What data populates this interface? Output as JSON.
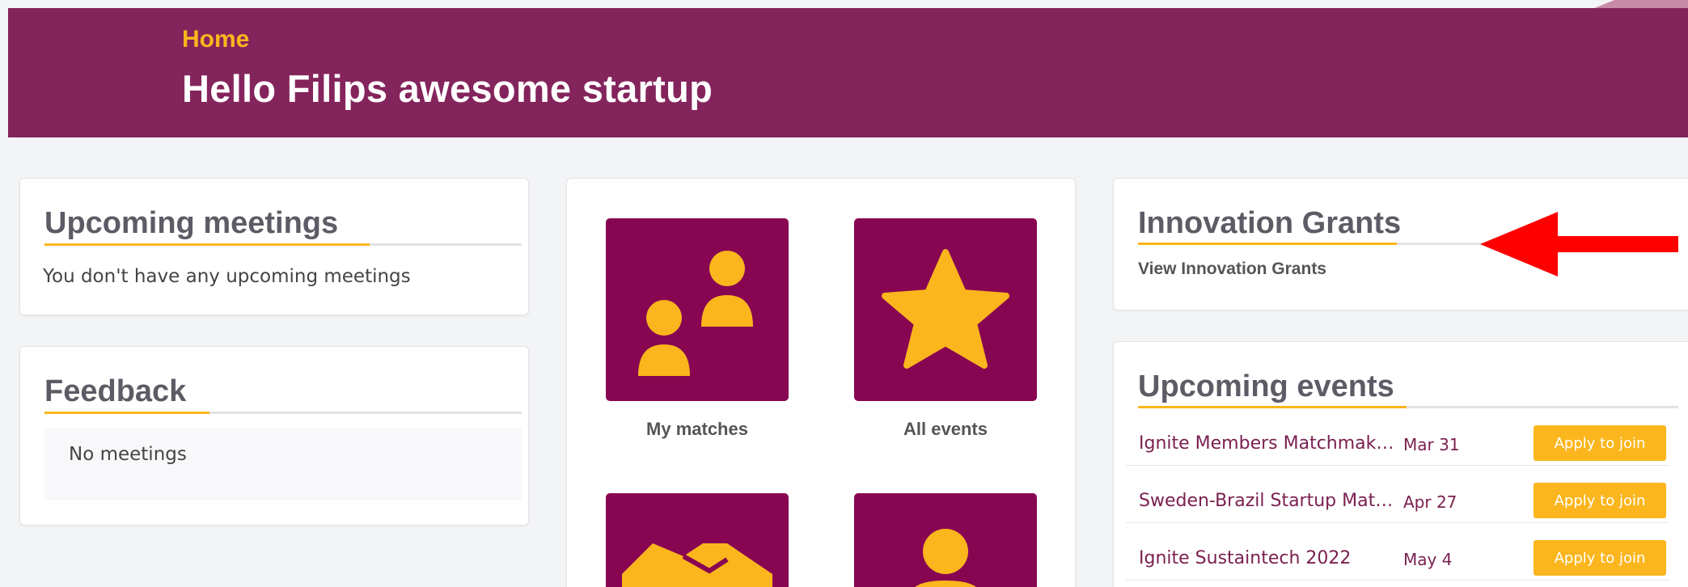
{
  "header": {
    "breadcrumb": "Home",
    "title": "Hello Filips awesome startup"
  },
  "meetings": {
    "title": "Upcoming meetings",
    "empty_text": "You don't have any upcoming meetings"
  },
  "feedback": {
    "title": "Feedback",
    "empty_text": "No meetings"
  },
  "tiles": [
    {
      "label": "My matches",
      "icon": "people-icon"
    },
    {
      "label": "All events",
      "icon": "star-icon"
    },
    {
      "label": "",
      "icon": "handshake-icon"
    },
    {
      "label": "",
      "icon": "person-icon"
    }
  ],
  "grants": {
    "title": "Innovation Grants",
    "link": "View Innovation Grants"
  },
  "events": {
    "title": "Upcoming events",
    "items": [
      {
        "name": "Ignite Members Matchmak…",
        "date": "Mar 31",
        "action": "Apply to join"
      },
      {
        "name": "Sweden-Brazil Startup Mat…",
        "date": "Apr 27",
        "action": "Apply to join"
      },
      {
        "name": "Ignite Sustaintech 2022",
        "date": "May 4",
        "action": "Apply to join"
      }
    ]
  },
  "colors": {
    "brand": "#84245c",
    "accent": "#fbb61d",
    "tile": "#880552",
    "annotation": "#ff0000"
  }
}
